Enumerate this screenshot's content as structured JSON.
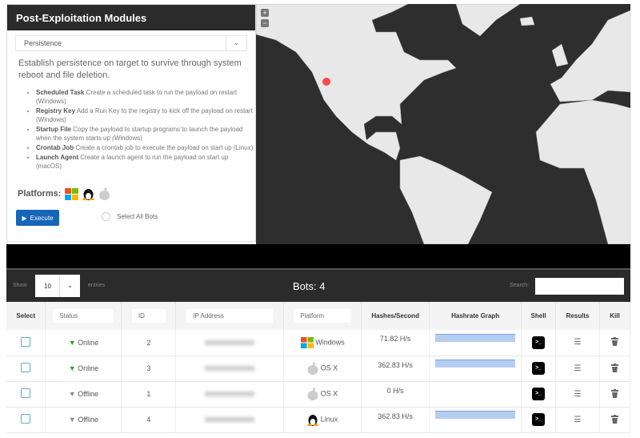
{
  "panel": {
    "title": "Post-Exploitation Modules",
    "module_select": "Persistence",
    "description": "Establish persistence on target to survive through system reboot and file deletion.",
    "items": [
      {
        "name": "Scheduled Task",
        "text": "Create a scheduled task to run the payload on restart (Windows)"
      },
      {
        "name": "Registry Key",
        "text": "Add a Run Key to the registry to kick off the payload on restart (Windows)"
      },
      {
        "name": "Startup File",
        "text": "Copy the payload to startup programs to launch the payload when the system starts up (Windows)"
      },
      {
        "name": "Crontab Job",
        "text": "Create a crontab job to execute the payload on start up (Linux)"
      },
      {
        "name": "Launch Agent",
        "text": "Create a launch agent to run the payload on start up (macOS)"
      }
    ],
    "platforms_label": "Platforms:",
    "execute_label": "Execute",
    "select_all_label": "Select All Bots"
  },
  "map": {
    "zoom_in": "+",
    "zoom_out": "−",
    "marker_color": "#ff4a4a"
  },
  "table_header": {
    "show": "Show",
    "length": "10",
    "entries": "entries",
    "title": "Bots: 4",
    "search_label": "Search:"
  },
  "columns": [
    "Select",
    "Status",
    "ID",
    "IP Address",
    "Platform",
    "Hashes/Second",
    "Hashrate Graph",
    "Shell",
    "Results",
    "Kill"
  ],
  "rows": [
    {
      "status": "Online",
      "id": "2",
      "platform": "Windows",
      "hashes": "71.82 H/s",
      "graph": true
    },
    {
      "status": "Online",
      "id": "3",
      "platform": "OS X",
      "hashes": "362.83 H/s",
      "graph": true
    },
    {
      "status": "Offline",
      "id": "1",
      "platform": "OS X",
      "hashes": "0 H/s",
      "graph": false
    },
    {
      "status": "Offline",
      "id": "4",
      "platform": "Linux",
      "hashes": "362.83 H/s",
      "graph": true
    }
  ]
}
